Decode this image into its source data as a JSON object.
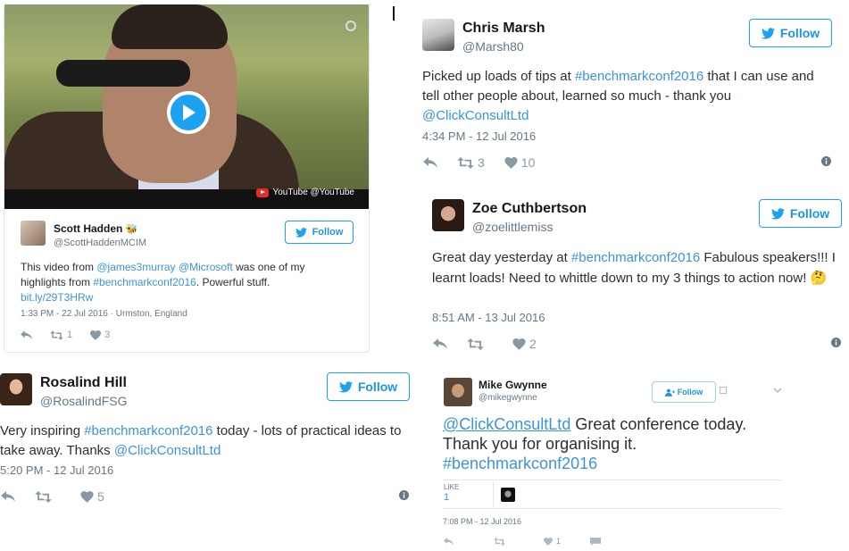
{
  "follow_label": "Follow",
  "tweets": [
    {
      "name": "Scott Hadden",
      "badge": "🐝",
      "handle": "@ScottHaddenMCIM",
      "text_parts": [
        "This video from ",
        "@james3murray",
        " ",
        "@Microsoft",
        " was one of my highlights from ",
        "#benchmarkconf2016",
        ". Powerful stuff. ",
        "bit.ly/29T3HRw"
      ],
      "timestamp": "1:33 PM - 22 Jul 2016 · Urmston, England",
      "retweets": "1",
      "likes": "3",
      "video_source": "YouTube @YouTube"
    },
    {
      "name": "Chris Marsh",
      "handle": "@Marsh80",
      "text_parts": [
        "Picked up loads of tips at ",
        "#benchmarkconf2016",
        " that I can use and tell other people about, learned so much - thank you ",
        "@ClickConsultLtd"
      ],
      "timestamp": "4:34 PM - 12 Jul 2016",
      "retweets": "3",
      "likes": "10"
    },
    {
      "name": "Zoe Cuthbertson",
      "handle": "@zoelittlemiss",
      "text_parts": [
        "Great day yesterday at ",
        "#benchmarkconf2016",
        " Fabulous speakers!!! I learnt loads! Need to whittle down to my 3 things to action now! ",
        "🤔"
      ],
      "timestamp": "8:51 AM - 13 Jul 2016",
      "retweets": "",
      "likes": "2"
    },
    {
      "name": "Rosalind Hill",
      "handle": "@RosalindFSG",
      "text_parts": [
        "Very inspiring ",
        "#benchmarkconf2016",
        " today - lots of practical ideas to take away. Thanks ",
        "@ClickConsultLtd"
      ],
      "timestamp": "5:20 PM - 12 Jul 2016",
      "retweets": "",
      "likes": "5"
    },
    {
      "name": "Mike Gwynne",
      "handle": "@mikegwynne",
      "text_parts": [
        "@ClickConsultLtd",
        " Great conference today. Thank you for organising it. ",
        "#benchmarkconf2016"
      ],
      "like_label": "LIKE",
      "like_count": "1",
      "timestamp": "7:08 PM - 12 Jul 2016",
      "likes": "1"
    }
  ],
  "colors": {
    "link": "#3b94d9",
    "follow_border": "#1da1f2",
    "muted": "#657786",
    "video_play": "#1da1f2"
  }
}
